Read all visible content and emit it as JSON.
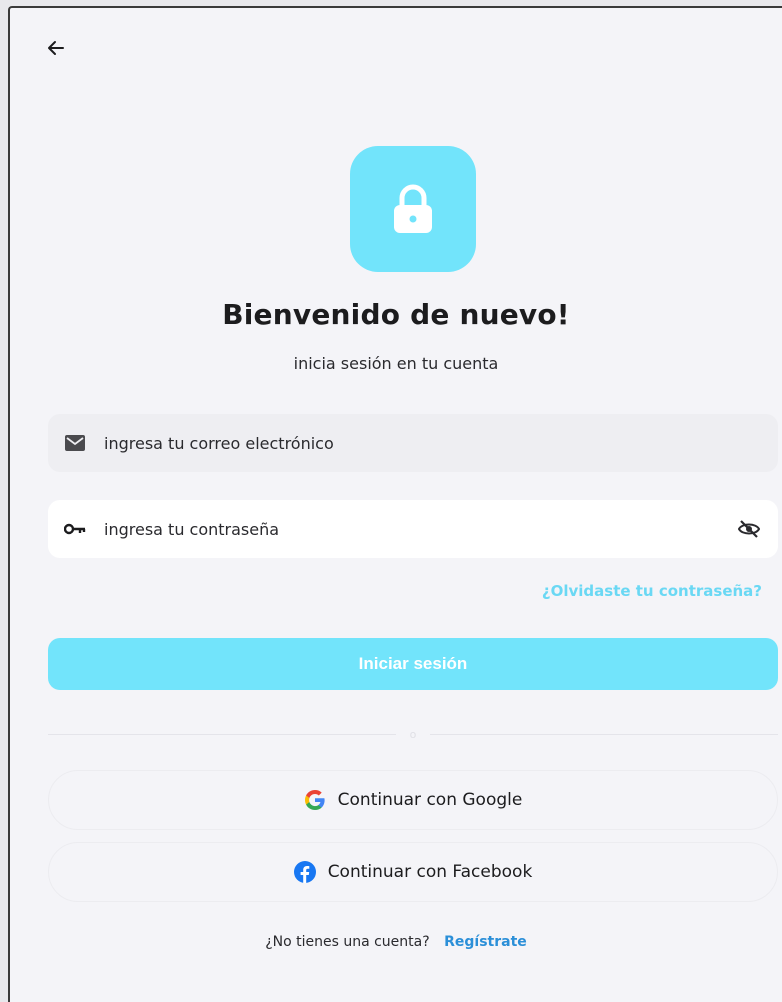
{
  "login": {
    "title": "Bienvenido de nuevo!",
    "subtitle": "inicia sesión en tu cuenta",
    "email_placeholder": "ingresa tu correo electrónico",
    "password_placeholder": "ingresa tu contraseña",
    "forgot_label": "¿Olvidaste tu contraseña?",
    "login_button": "Iniciar sesión",
    "divider_text": "o",
    "google_label": "Continuar con Google",
    "facebook_label": "Continuar con Facebook",
    "signup_prompt": "¿No tienes una cuenta?",
    "signup_link": "Regístrate"
  },
  "icons": {
    "back": "arrow-left-icon",
    "logo": "lock-icon",
    "email": "mail-icon",
    "password": "key-icon",
    "visibility": "eye-off-icon",
    "google": "google-icon",
    "facebook": "facebook-icon"
  },
  "colors": {
    "accent": "#72e4fb",
    "link": "#2b8fd8",
    "forgot": "#6ad8f4",
    "background": "#f4f4f8"
  }
}
